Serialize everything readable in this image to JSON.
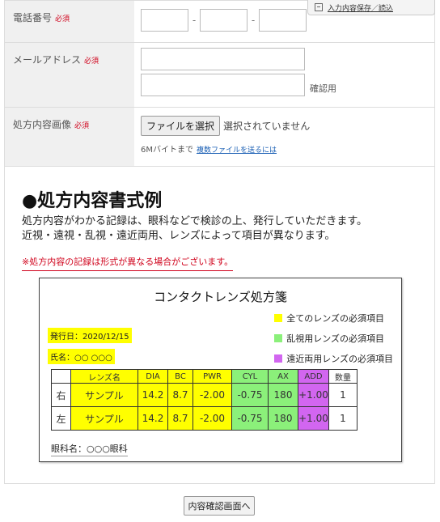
{
  "save_tab": {
    "label": "入力内容保存／読込"
  },
  "form": {
    "phone": {
      "label": "電話番号",
      "required": "必須",
      "sep": "-"
    },
    "email": {
      "label": "メールアドレス",
      "required": "必須",
      "confirm_label": "確認用"
    },
    "image": {
      "label": "処方内容画像",
      "required": "必須",
      "file_button": "ファイルを選択",
      "file_status": "選択されていません",
      "size_note": "6Mバイトまで",
      "multi_link": "複数ファイルを送るには"
    }
  },
  "section": {
    "title": "●処方内容書式例",
    "desc_line1": "処方内容がわかる記録は、眼科などで検診の上、発行していただきます。",
    "desc_line2": "近視・遠視・乱視・遠近両用、レンズによって項目が異なります。",
    "note": "※処方内容の記録は形式が異なる場合がございます。"
  },
  "prescription": {
    "title": "コンタクトレンズ処方箋",
    "legend": [
      {
        "label": "全てのレンズの必須項目",
        "color": "#ffff00"
      },
      {
        "label": "乱視用レンズの必須項目",
        "color": "#8bf07a"
      },
      {
        "label": "遠近両用レンズの必須項目",
        "color": "#d266f0"
      }
    ],
    "issue_date": "発行日：2020/12/15",
    "patient_name": "氏名：○○ ○○○",
    "headers": [
      "",
      "レンズ名",
      "DIA",
      "BC",
      "PWR",
      "CYL",
      "AX",
      "ADD",
      "数量"
    ],
    "rows": [
      [
        "右",
        "サンプル",
        "14.2",
        "8.7",
        "-2.00",
        "-0.75",
        "180",
        "+1.00",
        "1"
      ],
      [
        "左",
        "サンプル",
        "14.2",
        "8.7",
        "-2.00",
        "-0.75",
        "180",
        "+1.00",
        "1"
      ]
    ],
    "clinic": "眼科名：○○○眼科"
  },
  "next_button": "内容確認画面へ"
}
